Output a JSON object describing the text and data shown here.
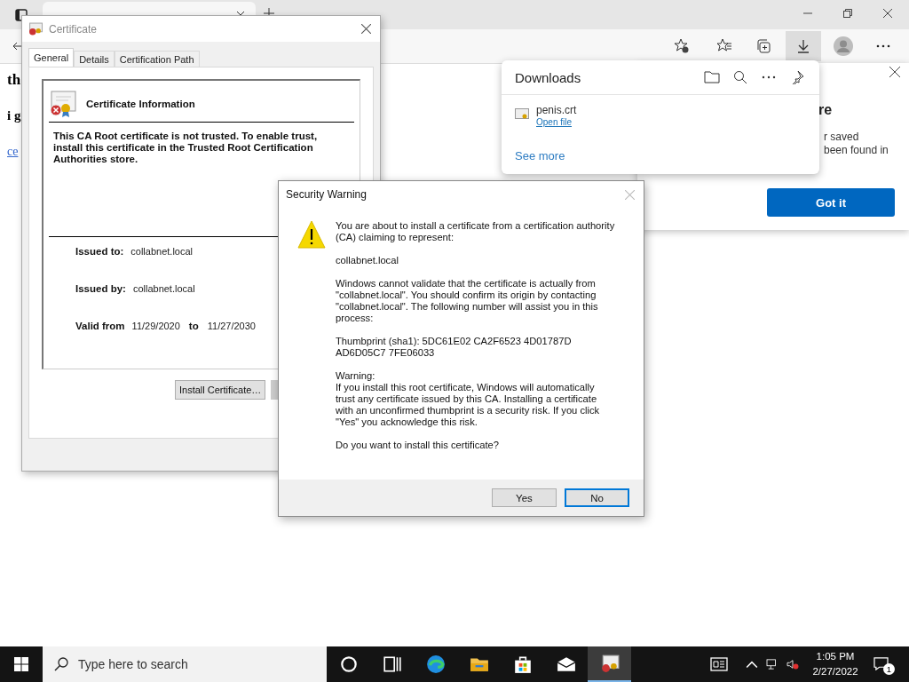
{
  "browser": {
    "page_heading": "th",
    "page_text": "i g",
    "page_link": "ce"
  },
  "notification": {
    "heading": "re",
    "lines": [
      "r saved",
      "been found in"
    ],
    "button": "Got it"
  },
  "downloads": {
    "title": "Downloads",
    "items": [
      {
        "name": "penis.crt",
        "action": "Open file"
      }
    ],
    "see_more": "See more"
  },
  "certificate_window": {
    "title": "Certificate",
    "tabs": [
      {
        "label": "General",
        "selected": true
      },
      {
        "label": "Details",
        "selected": false
      },
      {
        "label": "Certification Path",
        "selected": false
      }
    ],
    "heading": "Certificate Information",
    "message": "This CA Root certificate is not trusted. To enable trust, install this certificate in the Trusted Root Certification Authorities store.",
    "fields": [
      {
        "label": "Issued to:",
        "value": "collabnet.local"
      },
      {
        "label": "Issued by:",
        "value": "collabnet.local"
      }
    ],
    "valid": {
      "label": "Valid from",
      "from": "11/29/2020",
      "to_label": "to",
      "to": "11/27/2030"
    },
    "button": "Install Certificate…"
  },
  "security_warning": {
    "title": "Security Warning",
    "paragraphs": [
      "You are about to install a certificate from a certification authority (CA) claiming to represent:",
      "collabnet.local",
      "Windows cannot validate that the certificate is actually from \"collabnet.local\". You should confirm its origin by contacting \"collabnet.local\". The following number will assist you in this process:",
      "Thumbprint (sha1): 5DC61E02 CA2F6523 4D01787D AD6D05C7 7FE06033"
    ],
    "warning_label": "Warning:",
    "warning_text": "If you install this root certificate, Windows will automatically trust any certificate issued by this CA. Installing a certificate with an unconfirmed thumbprint is a security risk. If you click \"Yes\" you acknowledge this risk.",
    "question": "Do you want to install this certificate?",
    "buttons": [
      {
        "label": "Yes",
        "selected": false
      },
      {
        "label": "No",
        "selected": true
      }
    ]
  },
  "taskbar": {
    "search_placeholder": "Type here to search",
    "apps": [
      {
        "kind": "cortana",
        "active": false
      },
      {
        "kind": "taskview",
        "active": false
      },
      {
        "kind": "edge",
        "active": false
      },
      {
        "kind": "explorer",
        "active": false
      },
      {
        "kind": "store",
        "active": false
      },
      {
        "kind": "mail",
        "active": false
      },
      {
        "kind": "certificate",
        "active": true
      }
    ],
    "time": "1:05 PM",
    "date": "2/27/2022",
    "notification_count": "1"
  }
}
